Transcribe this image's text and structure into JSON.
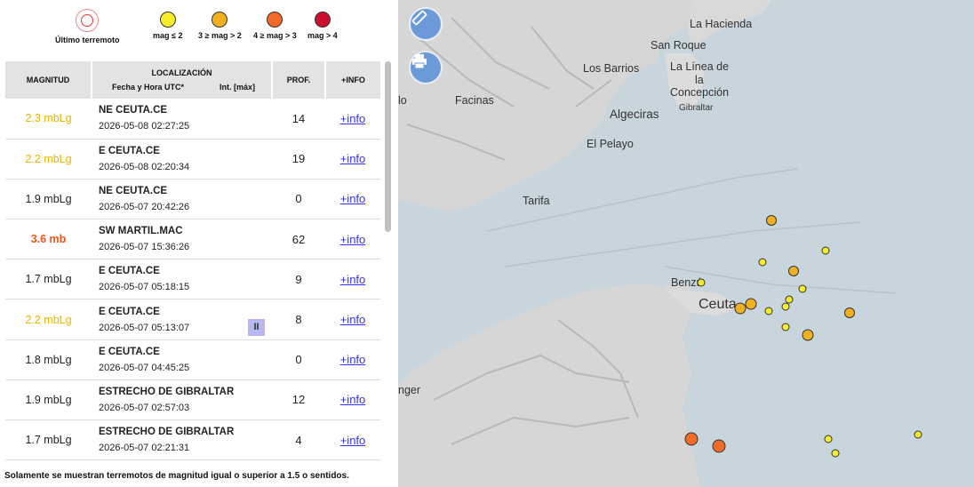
{
  "legend": {
    "last": "Último terremoto",
    "items": [
      {
        "label": "mag ≤ 2",
        "color": "#f5ec2a"
      },
      {
        "label": "3 ≥ mag > 2",
        "color": "#f0b020"
      },
      {
        "label": "4 ≥ mag > 3",
        "color": "#f06a28"
      },
      {
        "label": "mag > 4",
        "color": "#c8102e"
      }
    ]
  },
  "table": {
    "headers": {
      "magnitude": "MAGNITUD",
      "location": "LOCALIZACIÓN",
      "datetime": "Fecha y Hora UTC*",
      "intensity": "Int. [máx]",
      "depth": "PROF.",
      "info": "+INFO"
    },
    "rows": [
      {
        "mag": "2.3 mbLg",
        "cls": "m-yellow",
        "place": "NE CEUTA.CE",
        "date": "2026-05-08 02:27:25",
        "depth": "14",
        "info": "+info",
        "int": ""
      },
      {
        "mag": "2.2 mbLg",
        "cls": "m-yellow",
        "place": "E CEUTA.CE",
        "date": "2026-05-08 02:20:34",
        "depth": "19",
        "info": "+info",
        "int": ""
      },
      {
        "mag": "1.9 mbLg",
        "cls": "m-dark",
        "place": "NE CEUTA.CE",
        "date": "2026-05-07 20:42:26",
        "depth": "0",
        "info": "+info",
        "int": ""
      },
      {
        "mag": "3.6 mb",
        "cls": "m-red",
        "place": "SW MARTIL.MAC",
        "date": "2026-05-07 15:36:26",
        "depth": "62",
        "info": "+info",
        "int": ""
      },
      {
        "mag": "1.7 mbLg",
        "cls": "m-dark",
        "place": "E CEUTA.CE",
        "date": "2026-05-07 05:18:15",
        "depth": "9",
        "info": "+info",
        "int": ""
      },
      {
        "mag": "2.2 mbLg",
        "cls": "m-yellow",
        "place": "E CEUTA.CE",
        "date": "2026-05-07 05:13:07",
        "depth": "8",
        "info": "+info",
        "int": "II"
      },
      {
        "mag": "1.8 mbLg",
        "cls": "m-dark",
        "place": "E CEUTA.CE",
        "date": "2026-05-07 04:45:25",
        "depth": "0",
        "info": "+info",
        "int": ""
      },
      {
        "mag": "1.9 mbLg",
        "cls": "m-dark",
        "place": "ESTRECHO DE GIBRALTAR",
        "date": "2026-05-07 02:57:03",
        "depth": "12",
        "info": "+info",
        "int": ""
      },
      {
        "mag": "1.7 mbLg",
        "cls": "m-dark",
        "place": "ESTRECHO DE GIBRALTAR",
        "date": "2026-05-07 02:21:31",
        "depth": "4",
        "info": "+info",
        "int": ""
      }
    ]
  },
  "footnote": "Solamente se muestran terremotos de magnitud igual o superior a 1.5 o sentidos.",
  "map": {
    "labels": [
      "La Hacienda",
      "San Roque",
      "Los Barrios",
      "La Línea de",
      "la",
      "Concepción",
      "Gibraltar",
      "Facinas",
      "Algeciras",
      "El Pelayo",
      "Tarifa",
      "Benzú",
      "Ceuta",
      "nger",
      "lo"
    ],
    "buttons": {
      "measure": "ruler-icon",
      "print": "print-icon"
    }
  }
}
